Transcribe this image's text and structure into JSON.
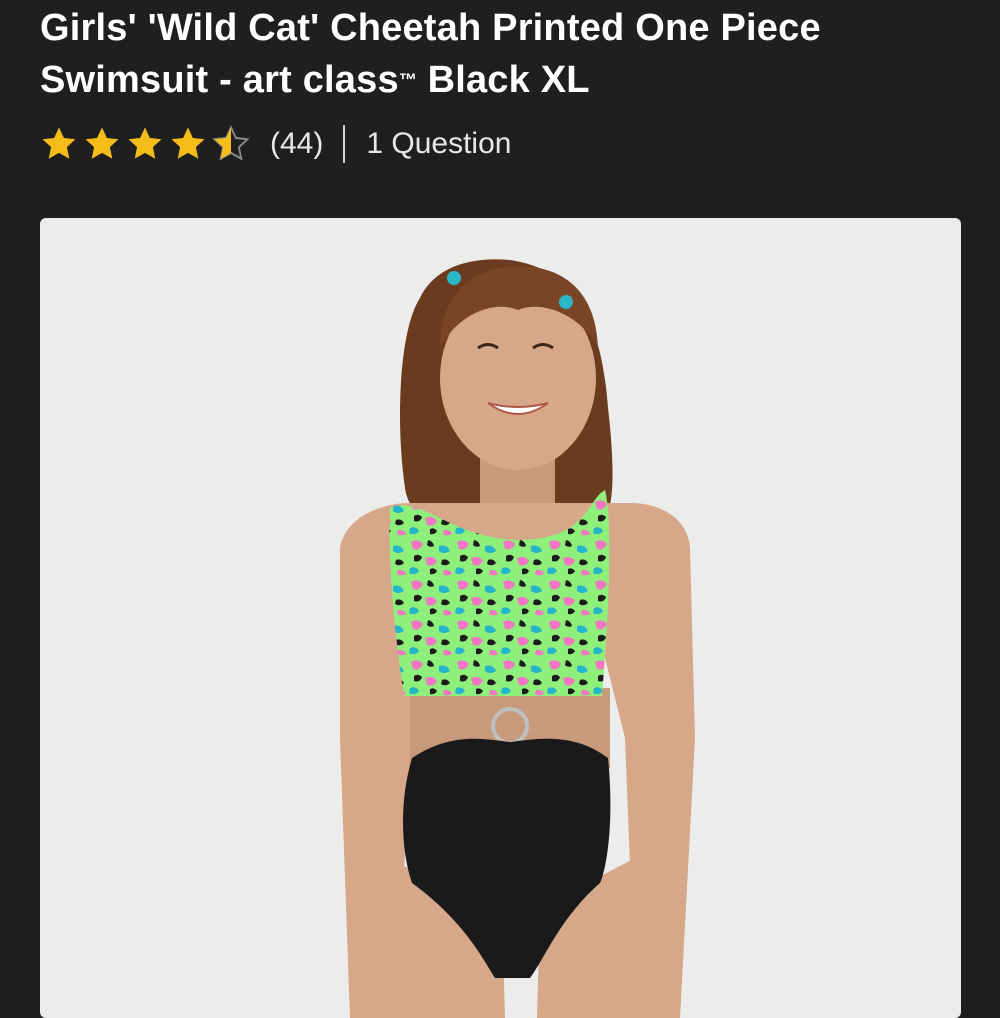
{
  "product": {
    "title_main": "Girls' 'Wild Cat' Cheetah Printed One Piece Swimsuit - art class",
    "title_tm": "TM",
    "title_variant": " Black XL",
    "image_alt": "Girls' 'Wild Cat' Cheetah Printed One Piece Swimsuit - art class Black XL"
  },
  "rating": {
    "value": 4.5,
    "max": 5,
    "review_count": "(44)",
    "questions_label": "1 Question",
    "star_color": "#f5bd1a",
    "star_empty_color": "#8a8a8a"
  },
  "colors": {
    "background": "#1f1f1f",
    "image_background": "#ececeb"
  },
  "icons": {
    "star": "star-icon",
    "half_star": "half-star-icon"
  }
}
